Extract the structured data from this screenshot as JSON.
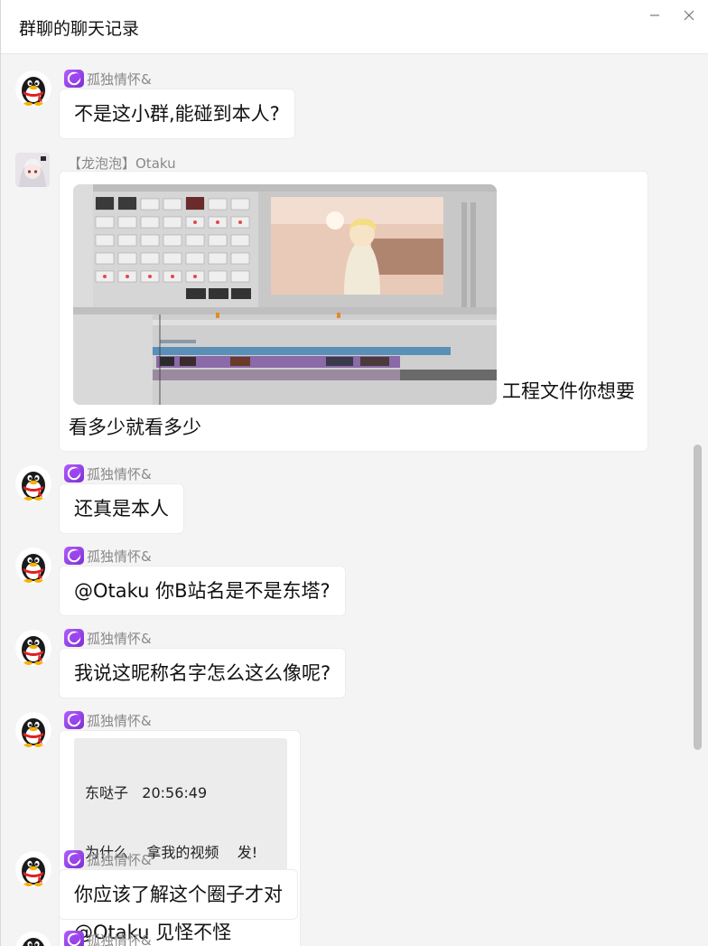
{
  "window": {
    "title": "群聊的聊天记录",
    "minimize_icon": "minimize-icon",
    "close_icon": "close-icon"
  },
  "colors": {
    "background": "#f4f4f4",
    "bubble": "#ffffff",
    "sender_text": "#888888",
    "badge": "#9b45f0",
    "quote_bg": "#ececec"
  },
  "messages": [
    {
      "sender": "孤独情怀&",
      "avatar": "qq-penguin-avatar",
      "text": "不是这小群,能碰到本人?"
    },
    {
      "sender": "【龙泡泡】Otaku",
      "avatar": "anime-girl-avatar",
      "image": "video-editor-screenshot",
      "text_inline": "工程文件你想要",
      "text_line2": "看多少就看多少"
    },
    {
      "sender": "孤独情怀&",
      "avatar": "qq-penguin-avatar",
      "text": "还真是本人"
    },
    {
      "sender": "孤独情怀&",
      "avatar": "qq-penguin-avatar",
      "text": "@Otaku 你B站名是不是东塔?"
    },
    {
      "sender": "孤独情怀&",
      "avatar": "qq-penguin-avatar",
      "text": "我说这昵称名字怎么这么像呢?"
    },
    {
      "sender": "孤独情怀&",
      "avatar": "qq-penguin-avatar",
      "quote_line1": "东哒子   20:56:49",
      "quote_line2": "为什么    拿我的视频    发!",
      "text": "@Otaku 见怪不怪"
    },
    {
      "sender": "孤独情怀&",
      "avatar": "qq-penguin-avatar",
      "text": "你应该了解这个圈子才对"
    },
    {
      "sender": "孤独情怀&",
      "avatar": "qq-penguin-avatar"
    }
  ]
}
